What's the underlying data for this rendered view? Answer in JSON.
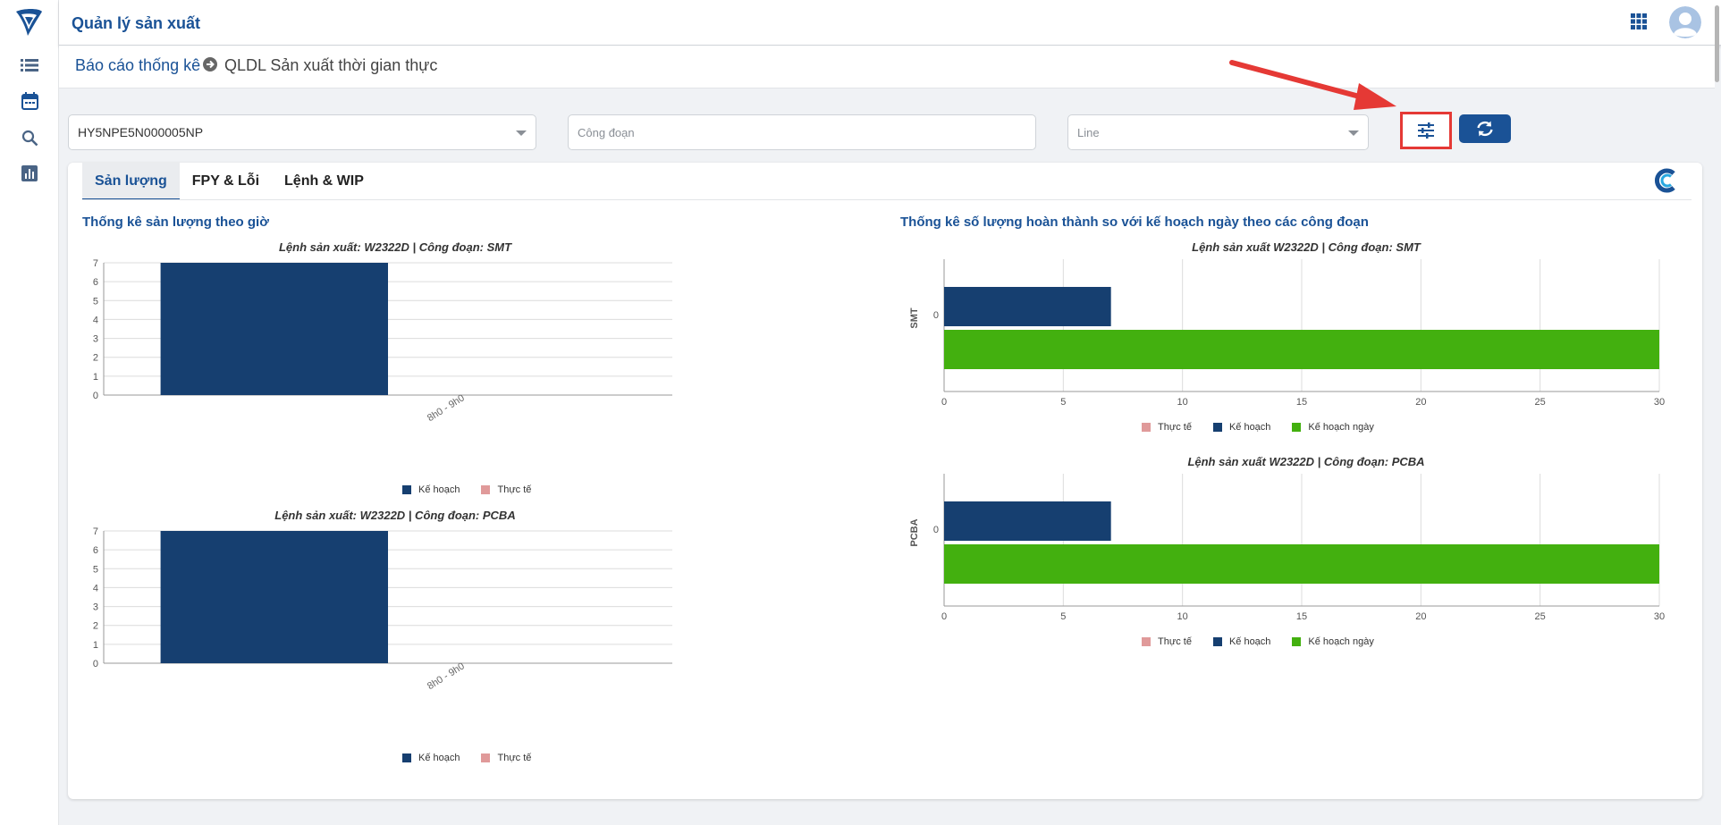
{
  "app": {
    "title": "Quản lý sản xuất"
  },
  "breadcrumb": {
    "parent": "Báo cáo thống kê",
    "current": "QLDL Sản xuất thời gian thực"
  },
  "filters": {
    "product_value": "HY5NPE5N000005NP",
    "stage_placeholder": "Công đoạn",
    "line_placeholder": "Line"
  },
  "tabs": [
    "Sản lượng",
    "FPY & Lỗi",
    "Lệnh & WIP"
  ],
  "sections": {
    "left_title": "Thống kê sản lượng theo giờ",
    "right_title": "Thống kê số lượng hoàn thành so với kế hoạch ngày theo các công đoạn"
  },
  "legend": {
    "plan": "Kế hoạch",
    "actual": "Thực tế",
    "daily_plan": "Kế hoạch ngày"
  },
  "colors": {
    "plan": "#163f70",
    "actual": "#e09a9a",
    "daily_plan": "#43b00f",
    "brand": "#1a5296"
  },
  "chart_data": [
    {
      "type": "bar",
      "title": "Lệnh sản xuất: W2322D | Công đoạn: SMT",
      "categories": [
        "8h0 - 9h0"
      ],
      "series": [
        {
          "name": "Kế hoạch",
          "values": [
            7
          ]
        },
        {
          "name": "Thực tế",
          "values": [
            0
          ]
        }
      ],
      "ylim": [
        0,
        7
      ],
      "yticks": [
        0,
        1,
        2,
        3,
        4,
        5,
        6,
        7
      ]
    },
    {
      "type": "bar",
      "title": "Lệnh sản xuất: W2322D | Công đoạn: PCBA",
      "categories": [
        "8h0 - 9h0"
      ],
      "series": [
        {
          "name": "Kế hoạch",
          "values": [
            7
          ]
        },
        {
          "name": "Thực tế",
          "values": [
            0
          ]
        }
      ],
      "ylim": [
        0,
        7
      ],
      "yticks": [
        0,
        1,
        2,
        3,
        4,
        5,
        6,
        7
      ]
    },
    {
      "type": "bar",
      "orientation": "horizontal",
      "title": "Lệnh sản xuất W2322D | Công đoạn: SMT",
      "category_axis_label": "SMT",
      "categories": [
        "0"
      ],
      "series": [
        {
          "name": "Thực tế",
          "values": [
            0
          ]
        },
        {
          "name": "Kế hoạch",
          "values": [
            7
          ]
        },
        {
          "name": "Kế hoạch ngày",
          "values": [
            30
          ]
        }
      ],
      "xlim": [
        0,
        30
      ],
      "xticks": [
        0,
        5,
        10,
        15,
        20,
        25,
        30
      ]
    },
    {
      "type": "bar",
      "orientation": "horizontal",
      "title": "Lệnh sản xuất W2322D | Công đoạn: PCBA",
      "category_axis_label": "PCBA",
      "categories": [
        "0"
      ],
      "series": [
        {
          "name": "Thực tế",
          "values": [
            0
          ]
        },
        {
          "name": "Kế hoạch",
          "values": [
            7
          ]
        },
        {
          "name": "Kế hoạch ngày",
          "values": [
            30
          ]
        }
      ],
      "xlim": [
        0,
        30
      ],
      "xticks": [
        0,
        5,
        10,
        15,
        20,
        25,
        30
      ]
    }
  ]
}
